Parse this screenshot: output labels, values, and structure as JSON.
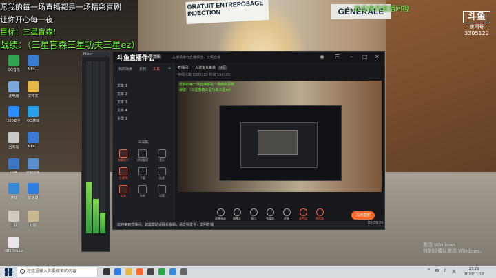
{
  "overlay_text": {
    "line1": "愿我的每一场直播都是一场精彩喜剧",
    "line2": "让你开心每一夜",
    "line3": "目标：三星盲森!",
    "line4": "战绩：（三星盲森三星功夫三星ez）",
    "top_right": "…欢迎来到直播间橙"
  },
  "watermark_logo": {
    "mark": "斗鱼",
    "sub": "房间号",
    "room": "3305122"
  },
  "street_signs": {
    "sign1": "GRATUIT ENTREPOSAGE INJECTION",
    "sign2": "GÉNÉRALE"
  },
  "desktop_icons": [
    {
      "label": "QQ音乐",
      "color": "#2fa44f"
    },
    {
      "label": "MP4…",
      "color": "#3a7bd5"
    },
    {
      "label": "此电脑",
      "color": "#7aa6d8"
    },
    {
      "label": "文件夹",
      "color": "#e6b84a"
    },
    {
      "label": "360安全",
      "color": "#2b8cff"
    },
    {
      "label": "QQ游戏",
      "color": "#2aa0e8"
    },
    {
      "label": "回收站",
      "color": "#c9c9c9"
    },
    {
      "label": "MP4…",
      "color": "#3a7bd5"
    },
    {
      "label": "网络",
      "color": "#3d76c4"
    },
    {
      "label": "控制面板",
      "color": "#5b8fd0"
    },
    {
      "label": "游戏",
      "color": "#3a89d6"
    },
    {
      "label": "加速器",
      "color": "#2f7de0"
    },
    {
      "label": "工具",
      "color": "#d0cac0"
    },
    {
      "label": "截图",
      "color": "#c9b78d"
    },
    {
      "label": "OBS Studio",
      "color": "#e8e8e8"
    }
  ],
  "mixer": {
    "title": "Mixer"
  },
  "app": {
    "brand": "斗鱼直播伴侣",
    "badge": "直播",
    "notice": "主播请遵守直播规范，文明直播",
    "tabs": {
      "scene": "我的场景",
      "material": "素材",
      "tools": "工具"
    },
    "scenes": [
      "文本 1",
      "文本 2",
      "文本 3",
      "文本 4",
      "全屏 1"
    ],
    "tools_title": "工具集",
    "tools": [
      {
        "label": "弹幕助手",
        "hot": true
      },
      {
        "label": "房间管理",
        "hot": false
      },
      {
        "label": "音乐",
        "hot": false
      },
      {
        "label": "主播PK",
        "hot": true
      },
      {
        "label": "下载",
        "hot": false
      },
      {
        "label": "连麦",
        "hot": false
      },
      {
        "label": "礼物",
        "hot": true
      },
      {
        "label": "鱼吧",
        "hot": false
      },
      {
        "label": "设置",
        "hot": false
      }
    ],
    "room_title": "直播间：一大波鱼丸来袭",
    "room_tag": "分区",
    "room_stats": "在线人数 3305122  热度 154105",
    "preview_overlay": [
      "愿我的每一场直播都是一场精彩喜剧",
      "战绩：（三星盲森三星功夫三星ez）"
    ],
    "bottom_buttons": [
      {
        "label": "直播画面",
        "red": false
      },
      {
        "label": "摄像头",
        "red": false
      },
      {
        "label": "窗口",
        "red": false
      },
      {
        "label": "多媒体",
        "red": false
      },
      {
        "label": "连麦",
        "red": false
      },
      {
        "label": "麦克风",
        "red": true
      },
      {
        "label": "扬声器",
        "red": true
      }
    ],
    "live_button": "关闭直播",
    "danmaku_text": "欢迎来到直播间，如需帮助请联系客服，请文明发言，文明直播",
    "timer": "03:39:26"
  },
  "taskbar": {
    "search_placeholder": "在这里输入你要搜索的内容",
    "tray_lang": "英",
    "time": "23:29",
    "date": "2020/11/12"
  },
  "activate_windows": {
    "line1": "激活 Windows",
    "line2": "转到设置以激活 Windows。"
  }
}
